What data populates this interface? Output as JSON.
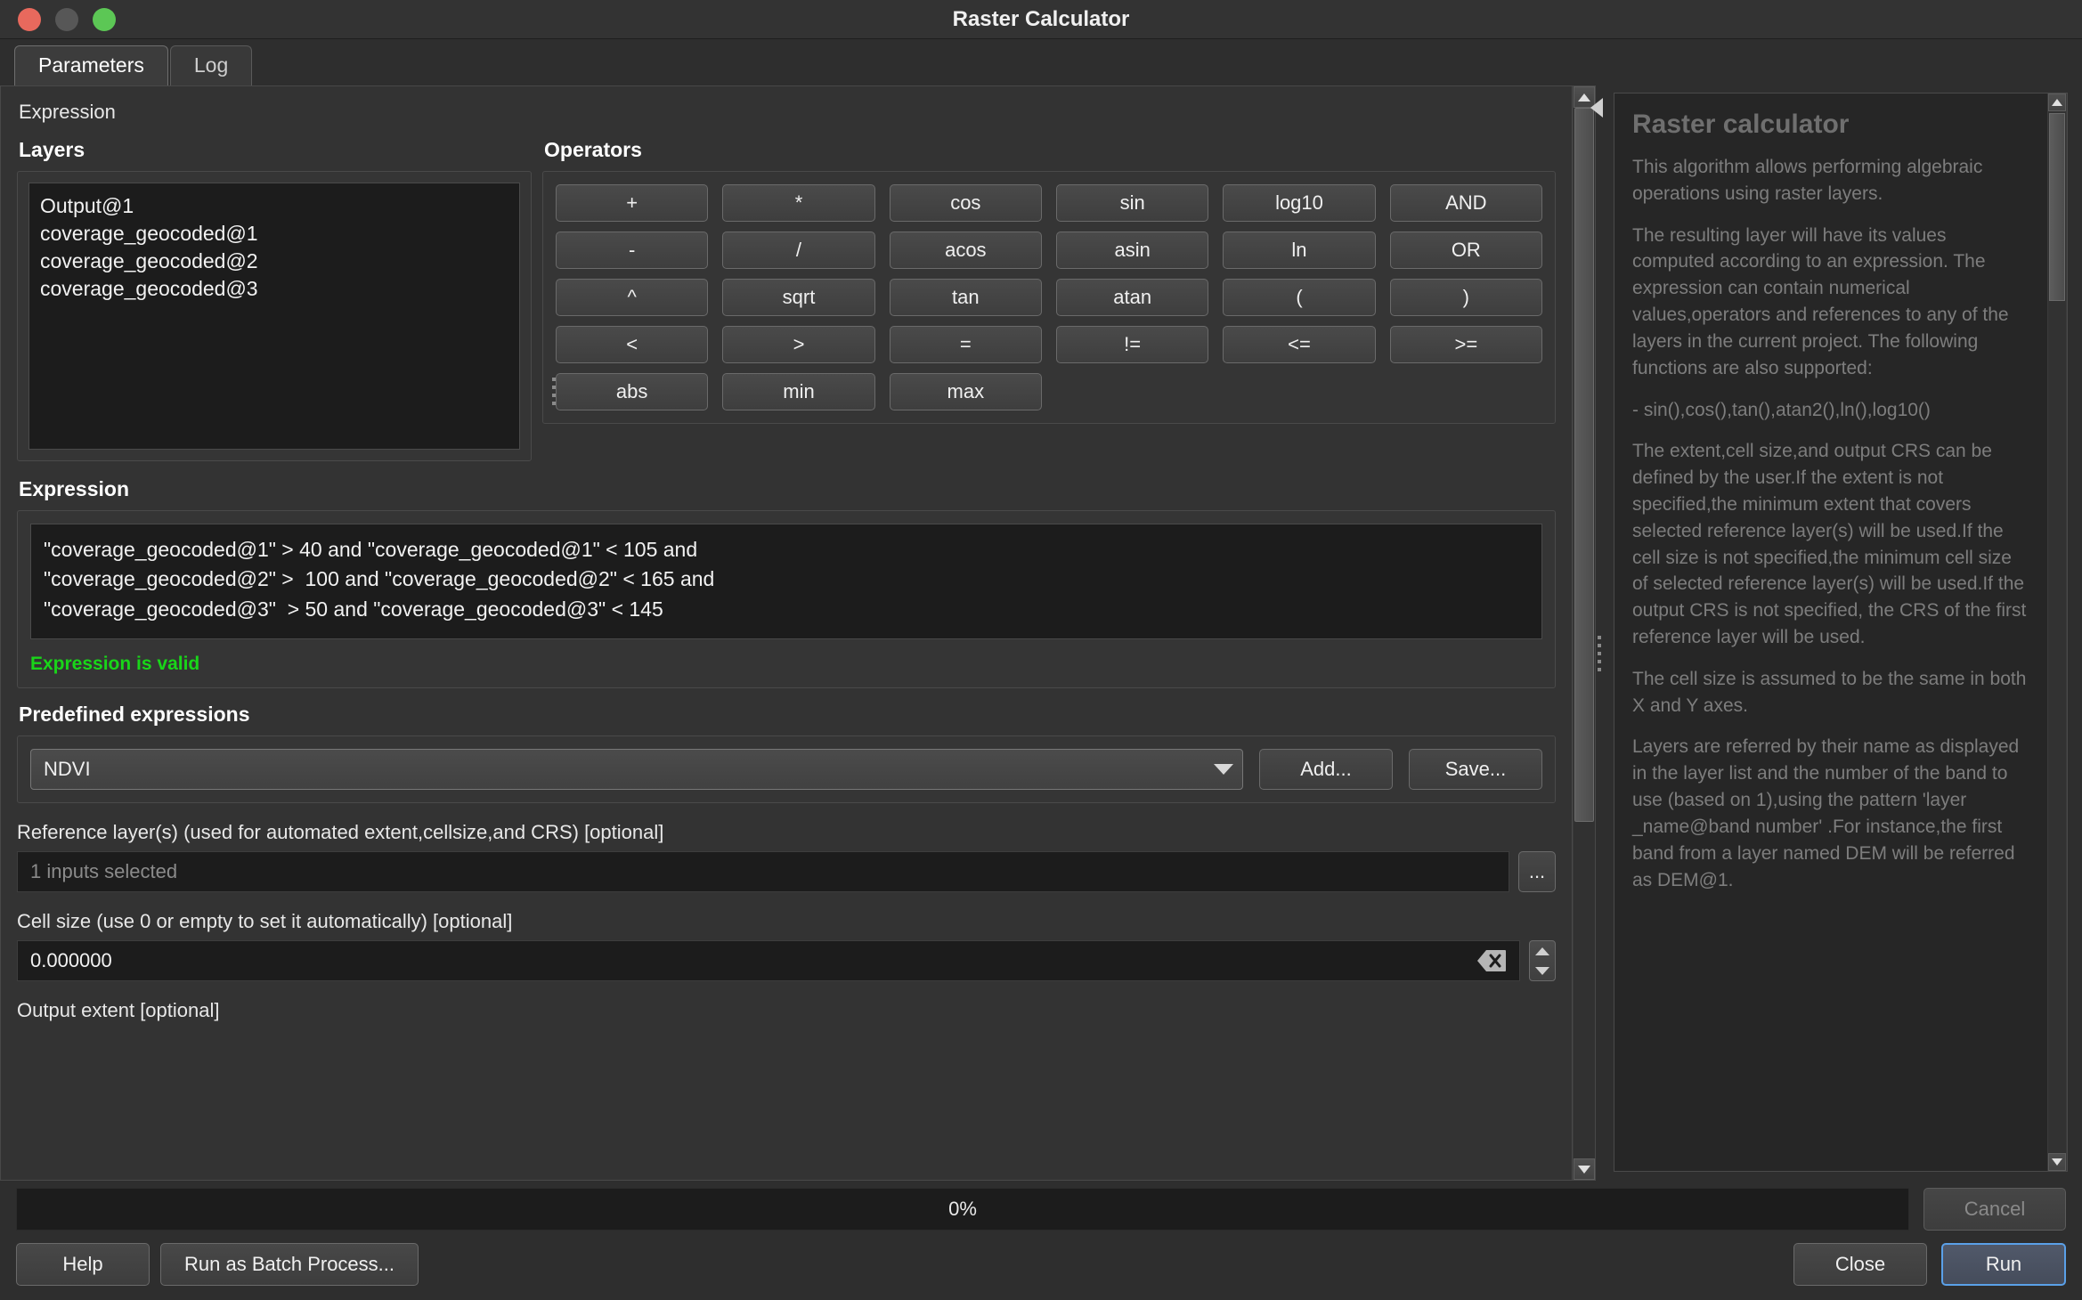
{
  "window": {
    "title": "Raster Calculator"
  },
  "titlebar": {
    "close": "close-button",
    "minimize": "minimize-button",
    "zoom": "zoom-button"
  },
  "tabs": [
    {
      "label": "Parameters",
      "active": true
    },
    {
      "label": "Log",
      "active": false
    }
  ],
  "parameters": {
    "expression_heading": "Expression",
    "layers": {
      "title": "Layers",
      "items": [
        "Output@1",
        "coverage_geocoded@1",
        "coverage_geocoded@2",
        "coverage_geocoded@3"
      ]
    },
    "operators": {
      "title": "Operators",
      "buttons": [
        "+",
        "*",
        "cos",
        "sin",
        "log10",
        "AND",
        "-",
        "/",
        "acos",
        "asin",
        "ln",
        "OR",
        "^",
        "sqrt",
        "tan",
        "atan",
        "(",
        ")",
        "<",
        ">",
        "=",
        "!=",
        "<=",
        ">=",
        "abs",
        "min",
        "max"
      ]
    },
    "expression": {
      "title": "Expression",
      "lines": [
        "\"coverage_geocoded@1\" > 40 and \"coverage_geocoded@1\" < 105 and",
        "\"coverage_geocoded@2\" >  100 and \"coverage_geocoded@2\" < 165 and",
        "\"coverage_geocoded@3\"  > 50 and \"coverage_geocoded@3\" < 145"
      ],
      "status": "Expression is valid",
      "status_color": "#19d619"
    },
    "predefined": {
      "title": "Predefined expressions",
      "selected": "NDVI",
      "add_label": "Add...",
      "save_label": "Save..."
    },
    "reference_layers": {
      "label": "Reference layer(s) (used for automated extent,cellsize,and CRS) [optional]",
      "value": "1 inputs selected",
      "browse_label": "..."
    },
    "cell_size": {
      "label": "Cell size (use 0 or empty to set it automatically) [optional]",
      "value": "0.000000"
    },
    "output_extent": {
      "label": "Output extent [optional]"
    }
  },
  "help": {
    "title": "Raster calculator",
    "paragraphs": [
      "This algorithm allows performing algebraic operations using raster layers.",
      "The resulting layer will have its values computed according to an expression. The expression can contain numerical values,operators and references to any of the layers in the current project. The following functions are also supported:",
      "- sin(),cos(),tan(),atan2(),ln(),log10()",
      "The extent,cell size,and output CRS can be defined by the user.If the extent is not specified,the minimum extent that covers selected reference layer(s) will be used.If the cell size is not specified,the minimum cell size of selected reference layer(s) will be used.If the output CRS is not specified, the CRS of the first reference layer will be used.",
      "The cell size is assumed to be the same in both X and Y axes.",
      "Layers are referred by their name as displayed in the layer list and the number of the band to use (based on 1),using the pattern 'layer _name@band number' .For instance,the first band from a layer named DEM will be referred as DEM@1."
    ]
  },
  "footer": {
    "progress": "0%",
    "cancel_label": "Cancel",
    "help_label": "Help",
    "batch_label": "Run as Batch Process...",
    "close_label": "Close",
    "run_label": "Run"
  }
}
